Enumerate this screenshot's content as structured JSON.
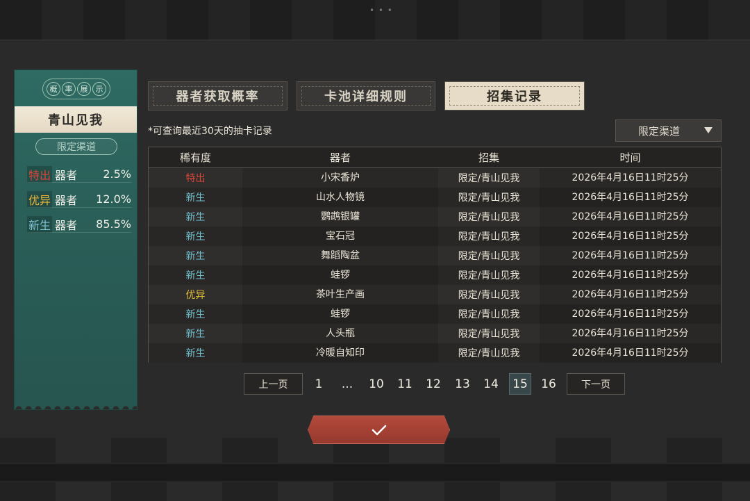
{
  "ticket": {
    "header": [
      "概",
      "率",
      "展",
      "示"
    ],
    "title": "青山见我",
    "channel": "限定渠道",
    "rates": [
      {
        "tier": "特出",
        "tier_color": "#e0443a",
        "type": "器者",
        "pct": "2.5%"
      },
      {
        "tier": "优异",
        "tier_color": "#e6b43a",
        "type": "器者",
        "pct": "12.0%"
      },
      {
        "tier": "新生",
        "tier_color": "#7fc4d4",
        "type": "器者",
        "pct": "85.5%"
      }
    ]
  },
  "tabs": [
    {
      "label": "器者获取概率",
      "active": false
    },
    {
      "label": "卡池详细规则",
      "active": false
    },
    {
      "label": "招集记录",
      "active": true
    }
  ],
  "note": "*可查询最近30天的抽卡记录",
  "dropdown": {
    "value": "限定渠道"
  },
  "table": {
    "headers": [
      "稀有度",
      "器者",
      "招集",
      "时间"
    ],
    "rows": [
      {
        "rarity": "特出",
        "color": "#e0443a",
        "name": "小宋香炉",
        "pool": "限定/青山见我",
        "time": "2026年4月16日11时25分"
      },
      {
        "rarity": "新生",
        "color": "#6fc0d0",
        "name": "山水人物镜",
        "pool": "限定/青山见我",
        "time": "2026年4月16日11时25分"
      },
      {
        "rarity": "新生",
        "color": "#6fc0d0",
        "name": "鹦鹉银罐",
        "pool": "限定/青山见我",
        "time": "2026年4月16日11时25分"
      },
      {
        "rarity": "新生",
        "color": "#6fc0d0",
        "name": "宝石冠",
        "pool": "限定/青山见我",
        "time": "2026年4月16日11时25分"
      },
      {
        "rarity": "新生",
        "color": "#6fc0d0",
        "name": "舞蹈陶盆",
        "pool": "限定/青山见我",
        "time": "2026年4月16日11时25分"
      },
      {
        "rarity": "新生",
        "color": "#6fc0d0",
        "name": "蛙锣",
        "pool": "限定/青山见我",
        "time": "2026年4月16日11时25分"
      },
      {
        "rarity": "优异",
        "color": "#e6c23a",
        "name": "茶叶生产画",
        "pool": "限定/青山见我",
        "time": "2026年4月16日11时25分"
      },
      {
        "rarity": "新生",
        "color": "#6fc0d0",
        "name": "蛙锣",
        "pool": "限定/青山见我",
        "time": "2026年4月16日11时25分"
      },
      {
        "rarity": "新生",
        "color": "#6fc0d0",
        "name": "人头瓶",
        "pool": "限定/青山见我",
        "time": "2026年4月16日11时25分"
      },
      {
        "rarity": "新生",
        "color": "#6fc0d0",
        "name": "冷暖自知印",
        "pool": "限定/青山见我",
        "time": "2026年4月16日11时25分"
      }
    ]
  },
  "pagination": {
    "prev": "上一页",
    "next": "下一页",
    "pages": [
      "1",
      "...",
      "10",
      "11",
      "12",
      "13",
      "14",
      "15",
      "16"
    ],
    "current": "15"
  },
  "confirm": {
    "icon": "checkmark-icon"
  }
}
